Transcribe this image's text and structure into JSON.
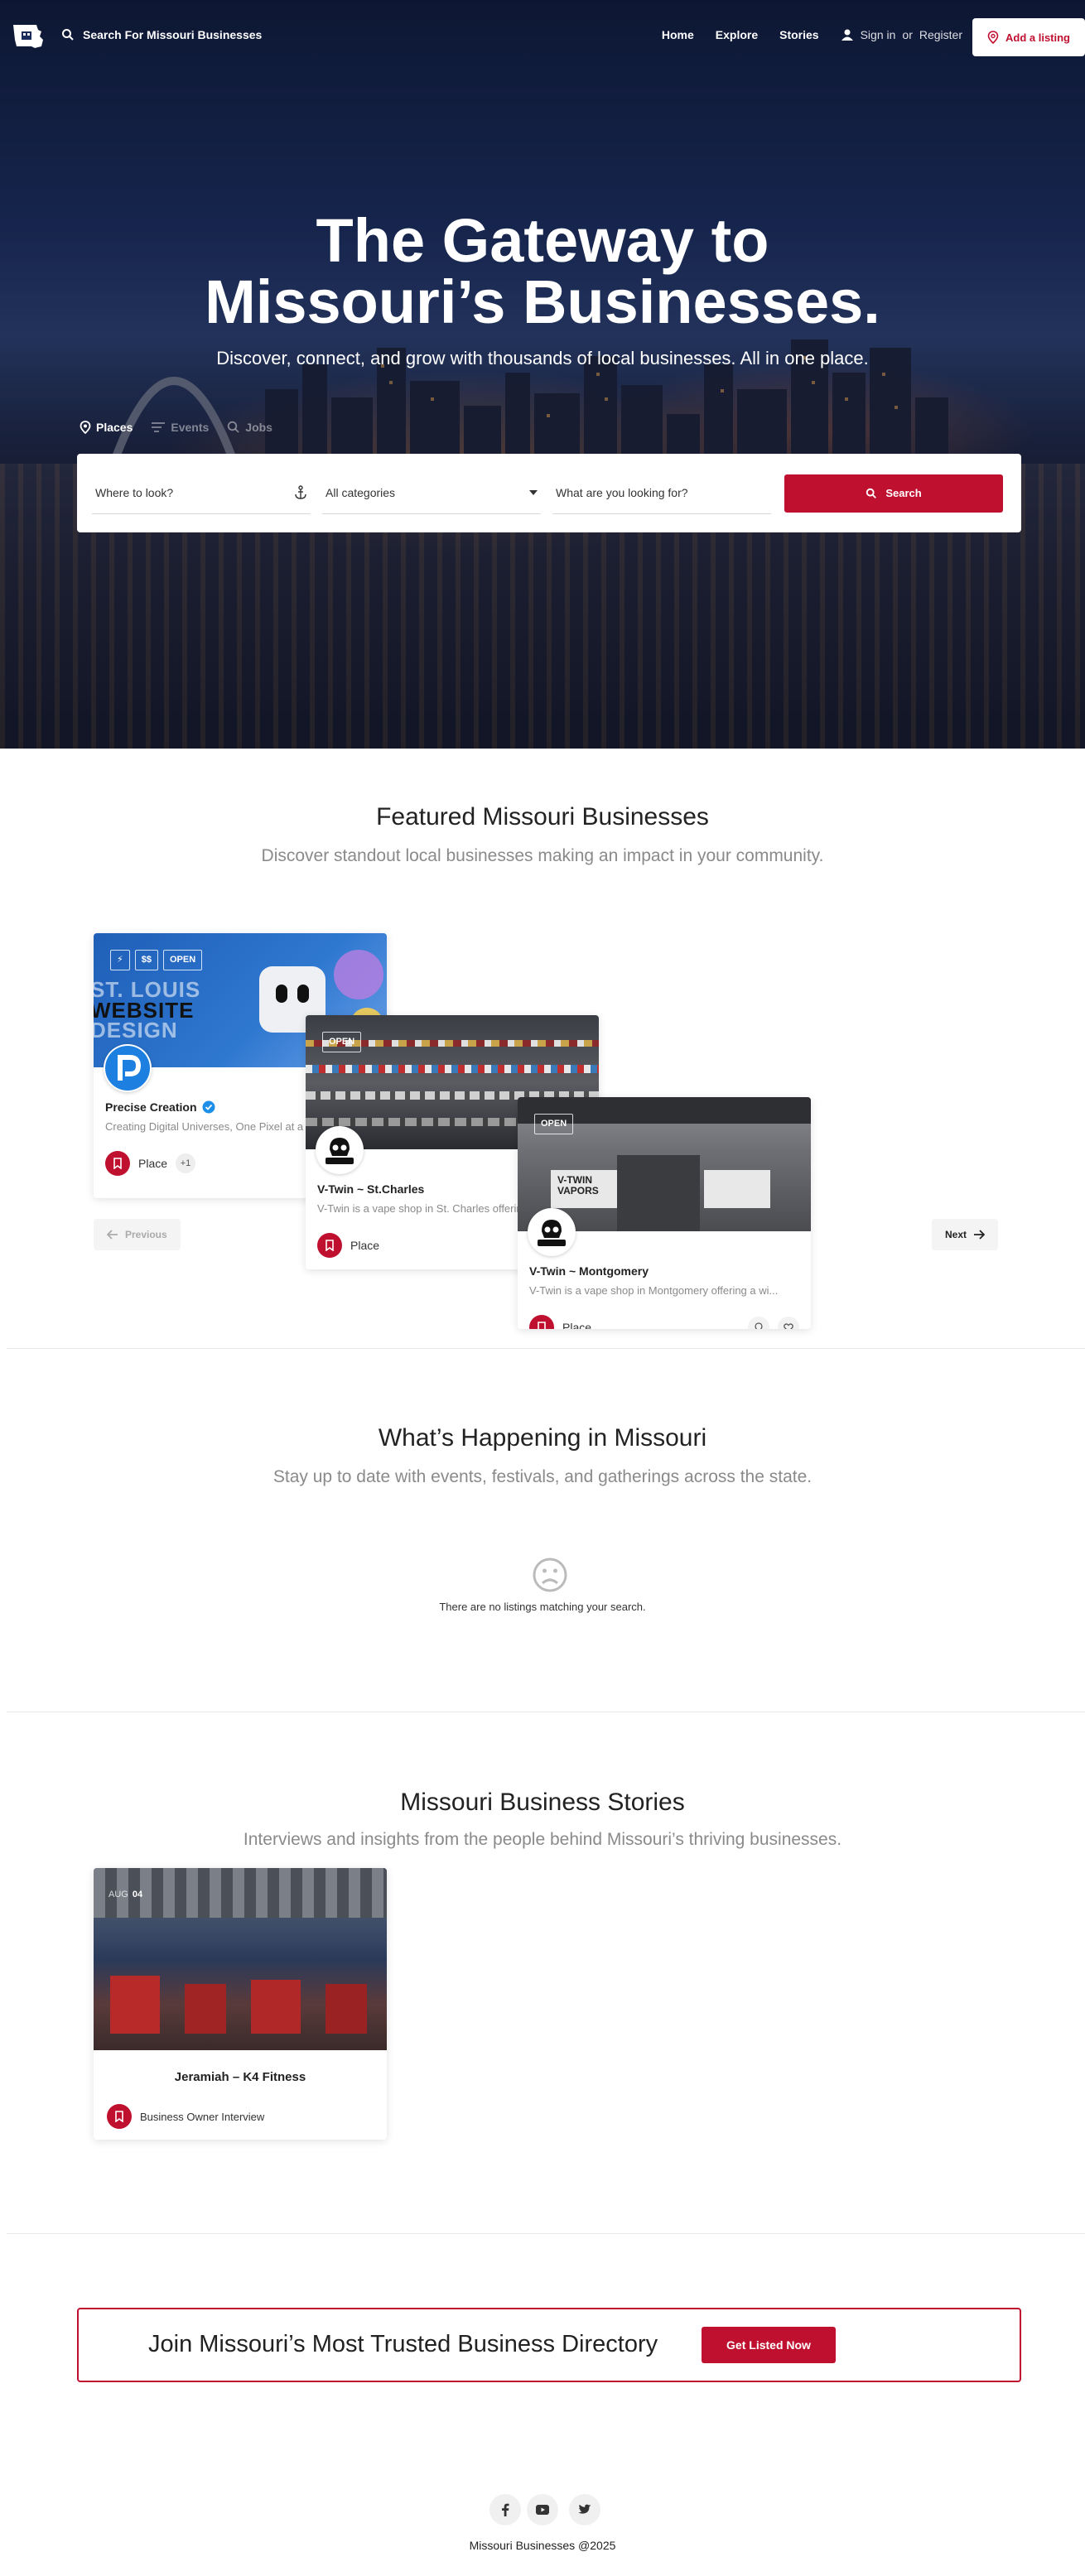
{
  "header": {
    "search_label": "Search For Missouri Businesses",
    "nav": [
      "Home",
      "Explore",
      "Stories"
    ],
    "sign_in": "Sign in",
    "or": "or",
    "register": "Register",
    "add_listing": "Add a listing"
  },
  "hero": {
    "title_line1": "The Gateway to",
    "title_line2": "Missouri’s Businesses.",
    "subtitle": "Discover, connect, and grow with thousands of local businesses. All in one place.",
    "tabs": [
      "Places",
      "Events",
      "Jobs"
    ],
    "where_placeholder": "Where to look?",
    "category_value": "All categories",
    "what_placeholder": "What are you looking for?",
    "search_button": "Search"
  },
  "featured": {
    "title": "Featured Missouri Businesses",
    "subtitle": "Discover standout local businesses making an impact in your community.",
    "cards": [
      {
        "name": "Precise Creation",
        "desc": "Creating Digital Universes, One Pixel at a Time",
        "badges": [
          "$$",
          "OPEN"
        ],
        "image_text": [
          "ST. LOUIS",
          "WEBSITE",
          "DESIGN"
        ],
        "category": "Place",
        "extra": "+1"
      },
      {
        "name": "V-Twin ~ St.Charles",
        "desc": "V-Twin is a vape shop in St. Charles offering a wide selection",
        "badges": [
          "OPEN"
        ],
        "category": "Place"
      },
      {
        "name": "V-Twin ~ Montgomery",
        "desc": "V-Twin is a vape shop in Montgomery offering a wi...",
        "badges": [
          "OPEN"
        ],
        "storefront_signs": [
          "V-TWIN",
          "VAPORS"
        ],
        "category": "Place"
      }
    ],
    "previous": "Previous",
    "next": "Next"
  },
  "events": {
    "title": "What’s Happening in Missouri",
    "subtitle": "Stay up to date with events, festivals, and gatherings across the state.",
    "empty": "There are no listings matching your search."
  },
  "stories": {
    "title": "Missouri Business Stories",
    "subtitle": "Interviews and insights from the people behind Missouri’s thriving businesses.",
    "card": {
      "month": "AUG",
      "day": "04",
      "title": "Jeramiah – K4 Fitness",
      "category": "Business Owner Interview"
    }
  },
  "cta": {
    "text": "Join Missouri’s Most Trusted Business Directory",
    "button": "Get Listed Now"
  },
  "footer": {
    "social": [
      "facebook-icon",
      "youtube-icon",
      "twitter-icon"
    ],
    "copyright": "Missouri Businesses @2025"
  },
  "colors": {
    "accent": "#c0102f",
    "muted_text": "#8a8a8a"
  }
}
